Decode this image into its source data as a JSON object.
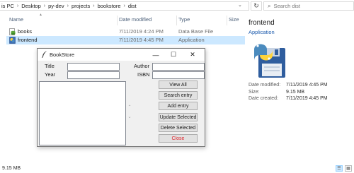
{
  "address": {
    "crumbs": [
      "is PC",
      "Desktop",
      "py-dev",
      "projects",
      "bookstore",
      "dist"
    ],
    "separator": "›",
    "refresh_icon": "refresh-icon",
    "search_placeholder": "Search dist"
  },
  "columns": {
    "name": "Name",
    "date_modified": "Date modified",
    "type": "Type",
    "size": "Size"
  },
  "files": [
    {
      "name": "books",
      "date": "7/11/2019 4:24 PM",
      "type": "Data Base File",
      "icon": "database-file-icon",
      "selected": false
    },
    {
      "name": "frontend",
      "date": "7/11/2019 4:45 PM",
      "type": "Application",
      "icon": "python-app-icon",
      "selected": true
    }
  ],
  "details": {
    "name": "frontend",
    "type": "Application",
    "props": [
      {
        "key": "Date modified:",
        "value": "7/11/2019 4:45 PM"
      },
      {
        "key": "Size:",
        "value": "9.15 MB"
      },
      {
        "key": "Date created:",
        "value": "7/11/2019 4:45 PM"
      }
    ]
  },
  "status": {
    "size": "9.15 MB"
  },
  "colors": {
    "accent": "#1e5cae",
    "selection": "#cce8ff",
    "close_red": "#e0242b"
  },
  "tk": {
    "title": "BookStore",
    "minimize": "—",
    "maximize": "☐",
    "close": "✕",
    "labels": {
      "title": "Title",
      "year": "Year",
      "author": "Author",
      "isbn": "ISBN"
    },
    "values": {
      "title": "",
      "year": "",
      "author": "",
      "isbn": ""
    },
    "buttons": {
      "view_all": "View All",
      "search": "Search entry",
      "add": "Add entry",
      "update": "Update Selected",
      "delete": "Delete Selected",
      "close": "Close"
    }
  }
}
